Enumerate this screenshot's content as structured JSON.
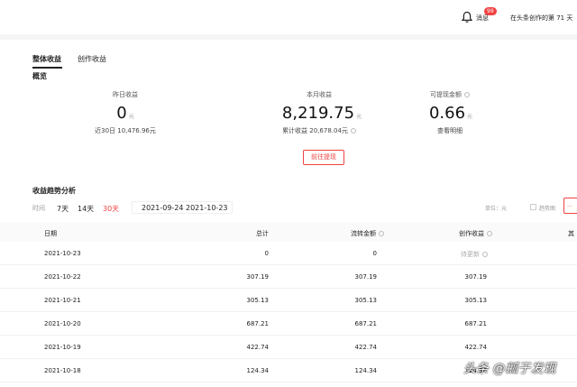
{
  "header": {
    "badge": "99",
    "messages_label": "消息",
    "days_text": "在头条创作的第 71 天"
  },
  "tabs": [
    {
      "label": "整体收益",
      "active": true
    },
    {
      "label": "创作收益",
      "active": false
    }
  ],
  "overview": {
    "title": "概览",
    "yesterday": {
      "label": "昨日收益",
      "value": "0",
      "unit": "元",
      "sub": "近30日 10,476.96元"
    },
    "month": {
      "label": "本月收益",
      "value": "8,219.75",
      "unit": "元",
      "sub": "累计收益 20,678.04元"
    },
    "withdrawable": {
      "label": "可提现金额",
      "value": "0.66",
      "unit": "元",
      "sub": "查看明细"
    },
    "withdraw_button": "前往提现"
  },
  "trend": {
    "title": "收益趋势分析",
    "time_label": "时间",
    "ranges": [
      "7天",
      "14天",
      "30天"
    ],
    "active_range": "30天",
    "start_date": "2021-09-24",
    "end_date": "2021-10-23",
    "unit_label": "单位：元",
    "trend_label": "趋势图",
    "columns": [
      "日期",
      "总计",
      "流转金额",
      "创作收益",
      "其"
    ],
    "rows": [
      {
        "date": "2021-10-23",
        "total": "0",
        "flow": "0",
        "creation": "待更新"
      },
      {
        "date": "2021-10-22",
        "total": "307.19",
        "flow": "307.19",
        "creation": "307.19"
      },
      {
        "date": "2021-10-21",
        "total": "305.13",
        "flow": "305.13",
        "creation": "305.13"
      },
      {
        "date": "2021-10-20",
        "total": "687.21",
        "flow": "687.21",
        "creation": "687.21"
      },
      {
        "date": "2021-10-19",
        "total": "422.74",
        "flow": "422.74",
        "creation": "422.74"
      },
      {
        "date": "2021-10-18",
        "total": "124.34",
        "flow": "124.34",
        "creation": "124.34"
      }
    ]
  },
  "watermark": "头条 @瓤于发现",
  "colors": {
    "accent": "#f04142",
    "text": "#222222",
    "muted": "#999999"
  }
}
